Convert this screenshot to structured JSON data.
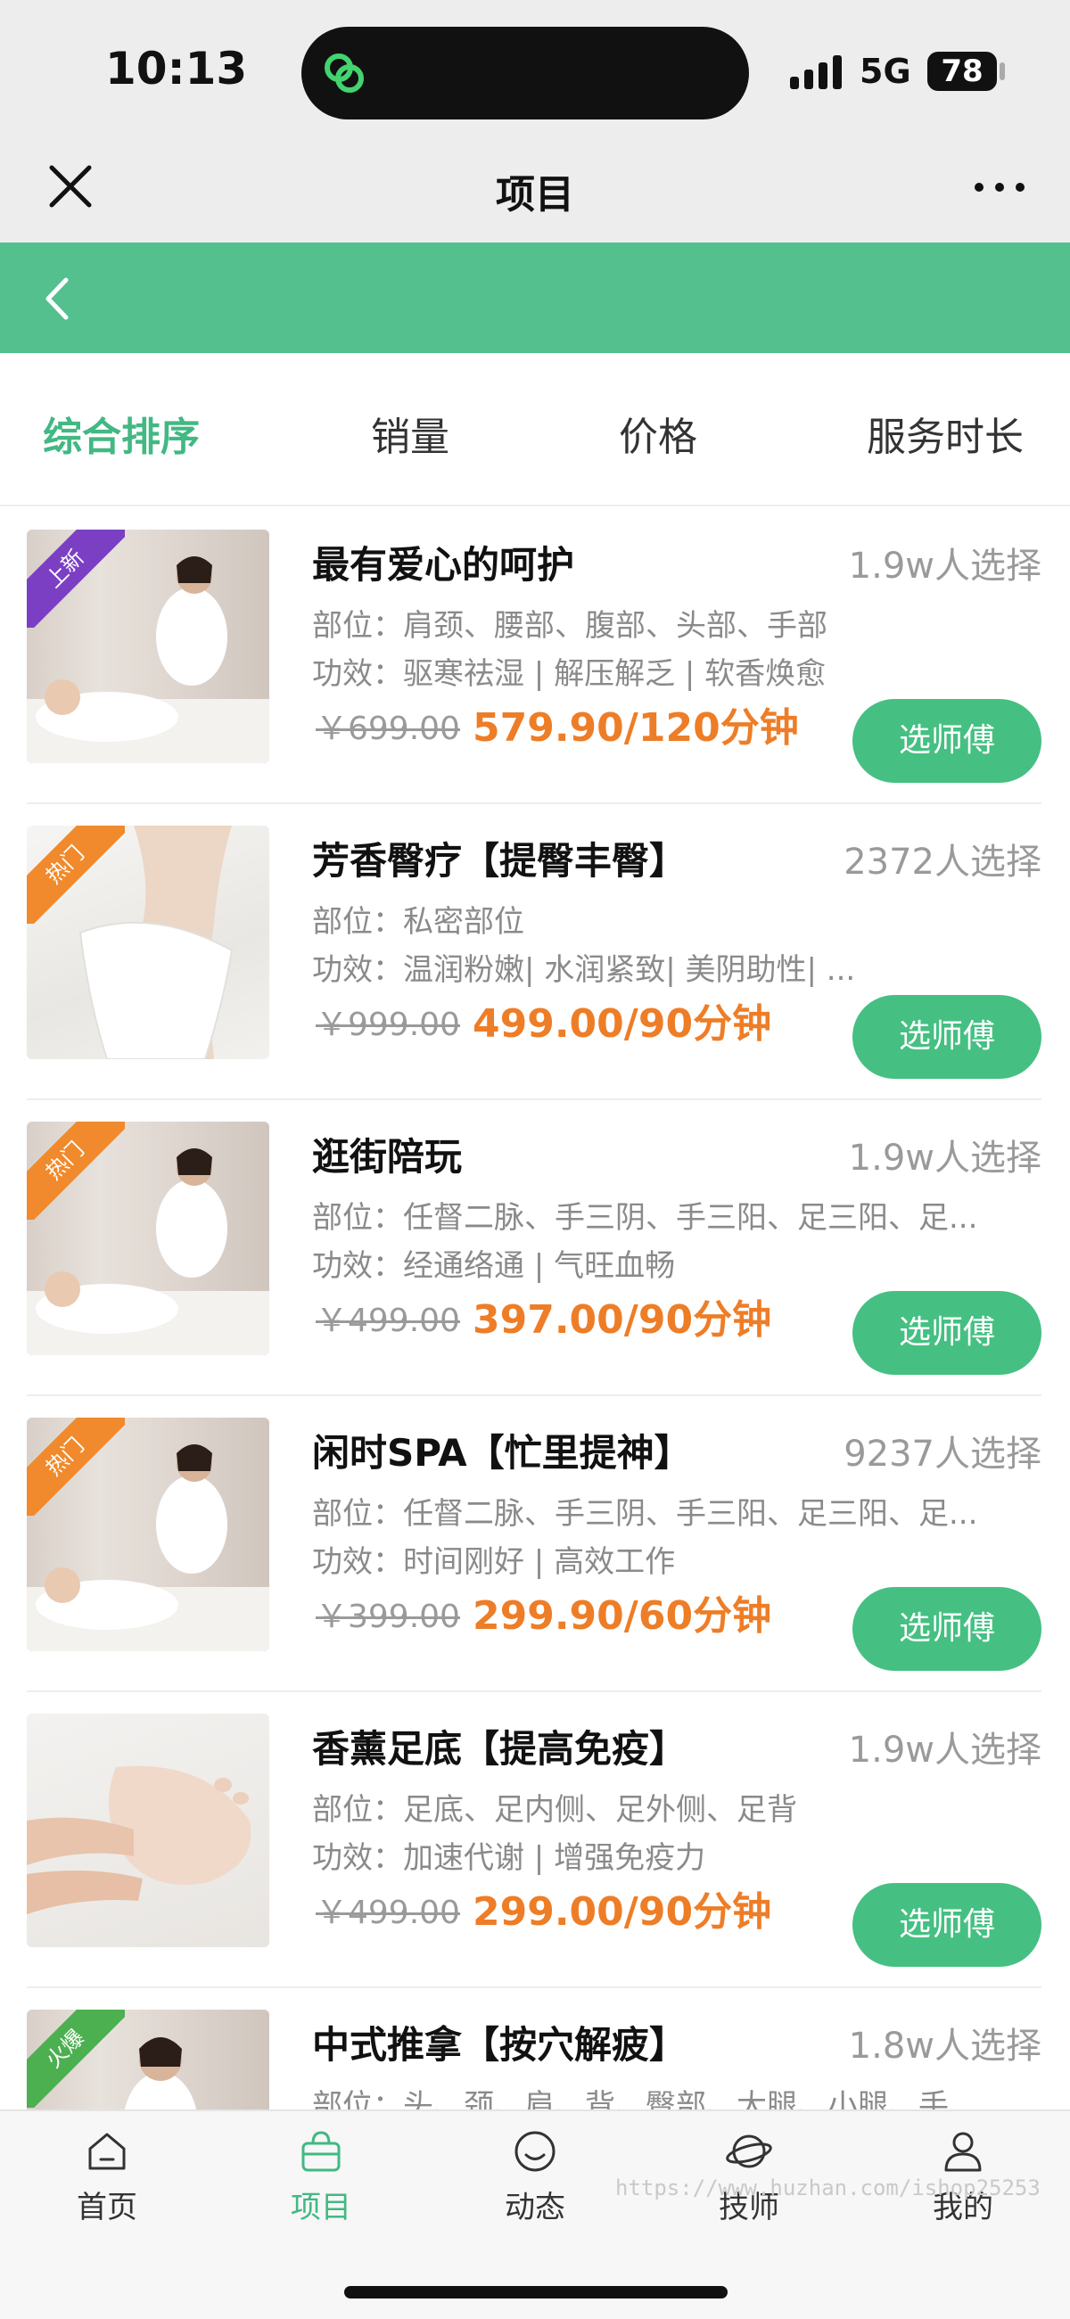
{
  "status_bar": {
    "time": "10:13",
    "network": "5G",
    "battery": "78"
  },
  "title_bar": {
    "title": "项目"
  },
  "sort_tabs": [
    {
      "label": "综合排序",
      "active": true
    },
    {
      "label": "销量",
      "active": false
    },
    {
      "label": "价格",
      "active": false
    },
    {
      "label": "服务时长",
      "active": false
    }
  ],
  "items": [
    {
      "badge": "上新",
      "title": "最有爱心的呵护",
      "count": "1.9w人选择",
      "part": "部位：肩颈、腰部、腹部、头部、手部",
      "effect": "功效：驱寒祛湿 | 解压解乏 | 软香焕愈",
      "old_price": "￥699.00",
      "price": "579.90/120分钟",
      "button": "选师傅"
    },
    {
      "badge": "热门",
      "title": "芳香臀疗【提臀丰臀】",
      "count": "2372人选择",
      "part": "部位：私密部位",
      "effect": "功效：温润粉嫩| 水润紧致| 美阴助性| ...",
      "old_price": "￥999.00",
      "price": "499.00/90分钟",
      "button": "选师傅"
    },
    {
      "badge": "热门",
      "title": "逛街陪玩",
      "count": "1.9w人选择",
      "part": "部位：任督二脉、手三阴、手三阳、足三阳、足...",
      "effect": "功效：经通络通 | 气旺血畅",
      "old_price": "￥499.00",
      "price": "397.00/90分钟",
      "button": "选师傅"
    },
    {
      "badge": "热门",
      "title": "闲时SPA【忙里提神】",
      "count": "9237人选择",
      "part": "部位：任督二脉、手三阴、手三阳、足三阳、足...",
      "effect": "功效：时间刚好 | 高效工作",
      "old_price": "￥399.00",
      "price": "299.90/60分钟",
      "button": "选师傅"
    },
    {
      "badge": "",
      "title": "香薰足底【提高免疫】",
      "count": "1.9w人选择",
      "part": "部位：足底、足内侧、足外侧、足背",
      "effect": "功效：加速代谢 | 增强免疫力",
      "old_price": "￥499.00",
      "price": "299.00/90分钟",
      "button": "选师傅"
    },
    {
      "badge": "火爆",
      "title": "中式推拿【按穴解疲】",
      "count": "1.8w人选择",
      "part": "部位：头、颈、肩、背、臀部、大腿、小腿、手",
      "effect": "",
      "old_price": "",
      "price": "",
      "button": ""
    }
  ],
  "tab_bar": {
    "tabs": [
      {
        "label": "首页",
        "icon": "home-icon"
      },
      {
        "label": "项目",
        "icon": "bag-icon"
      },
      {
        "label": "动态",
        "icon": "smile-icon"
      },
      {
        "label": "技师",
        "icon": "planet-icon"
      },
      {
        "label": "我的",
        "icon": "user-icon"
      }
    ],
    "watermark": "https://www.huzhan.com/ishop25253"
  },
  "colors": {
    "brand_green": "#53c08e",
    "price_orange": "#ee7d27",
    "button_green": "#45c082",
    "badge_purple": "#7b3fc4",
    "badge_orange": "#f08a2c",
    "badge_green": "#4caf50"
  }
}
